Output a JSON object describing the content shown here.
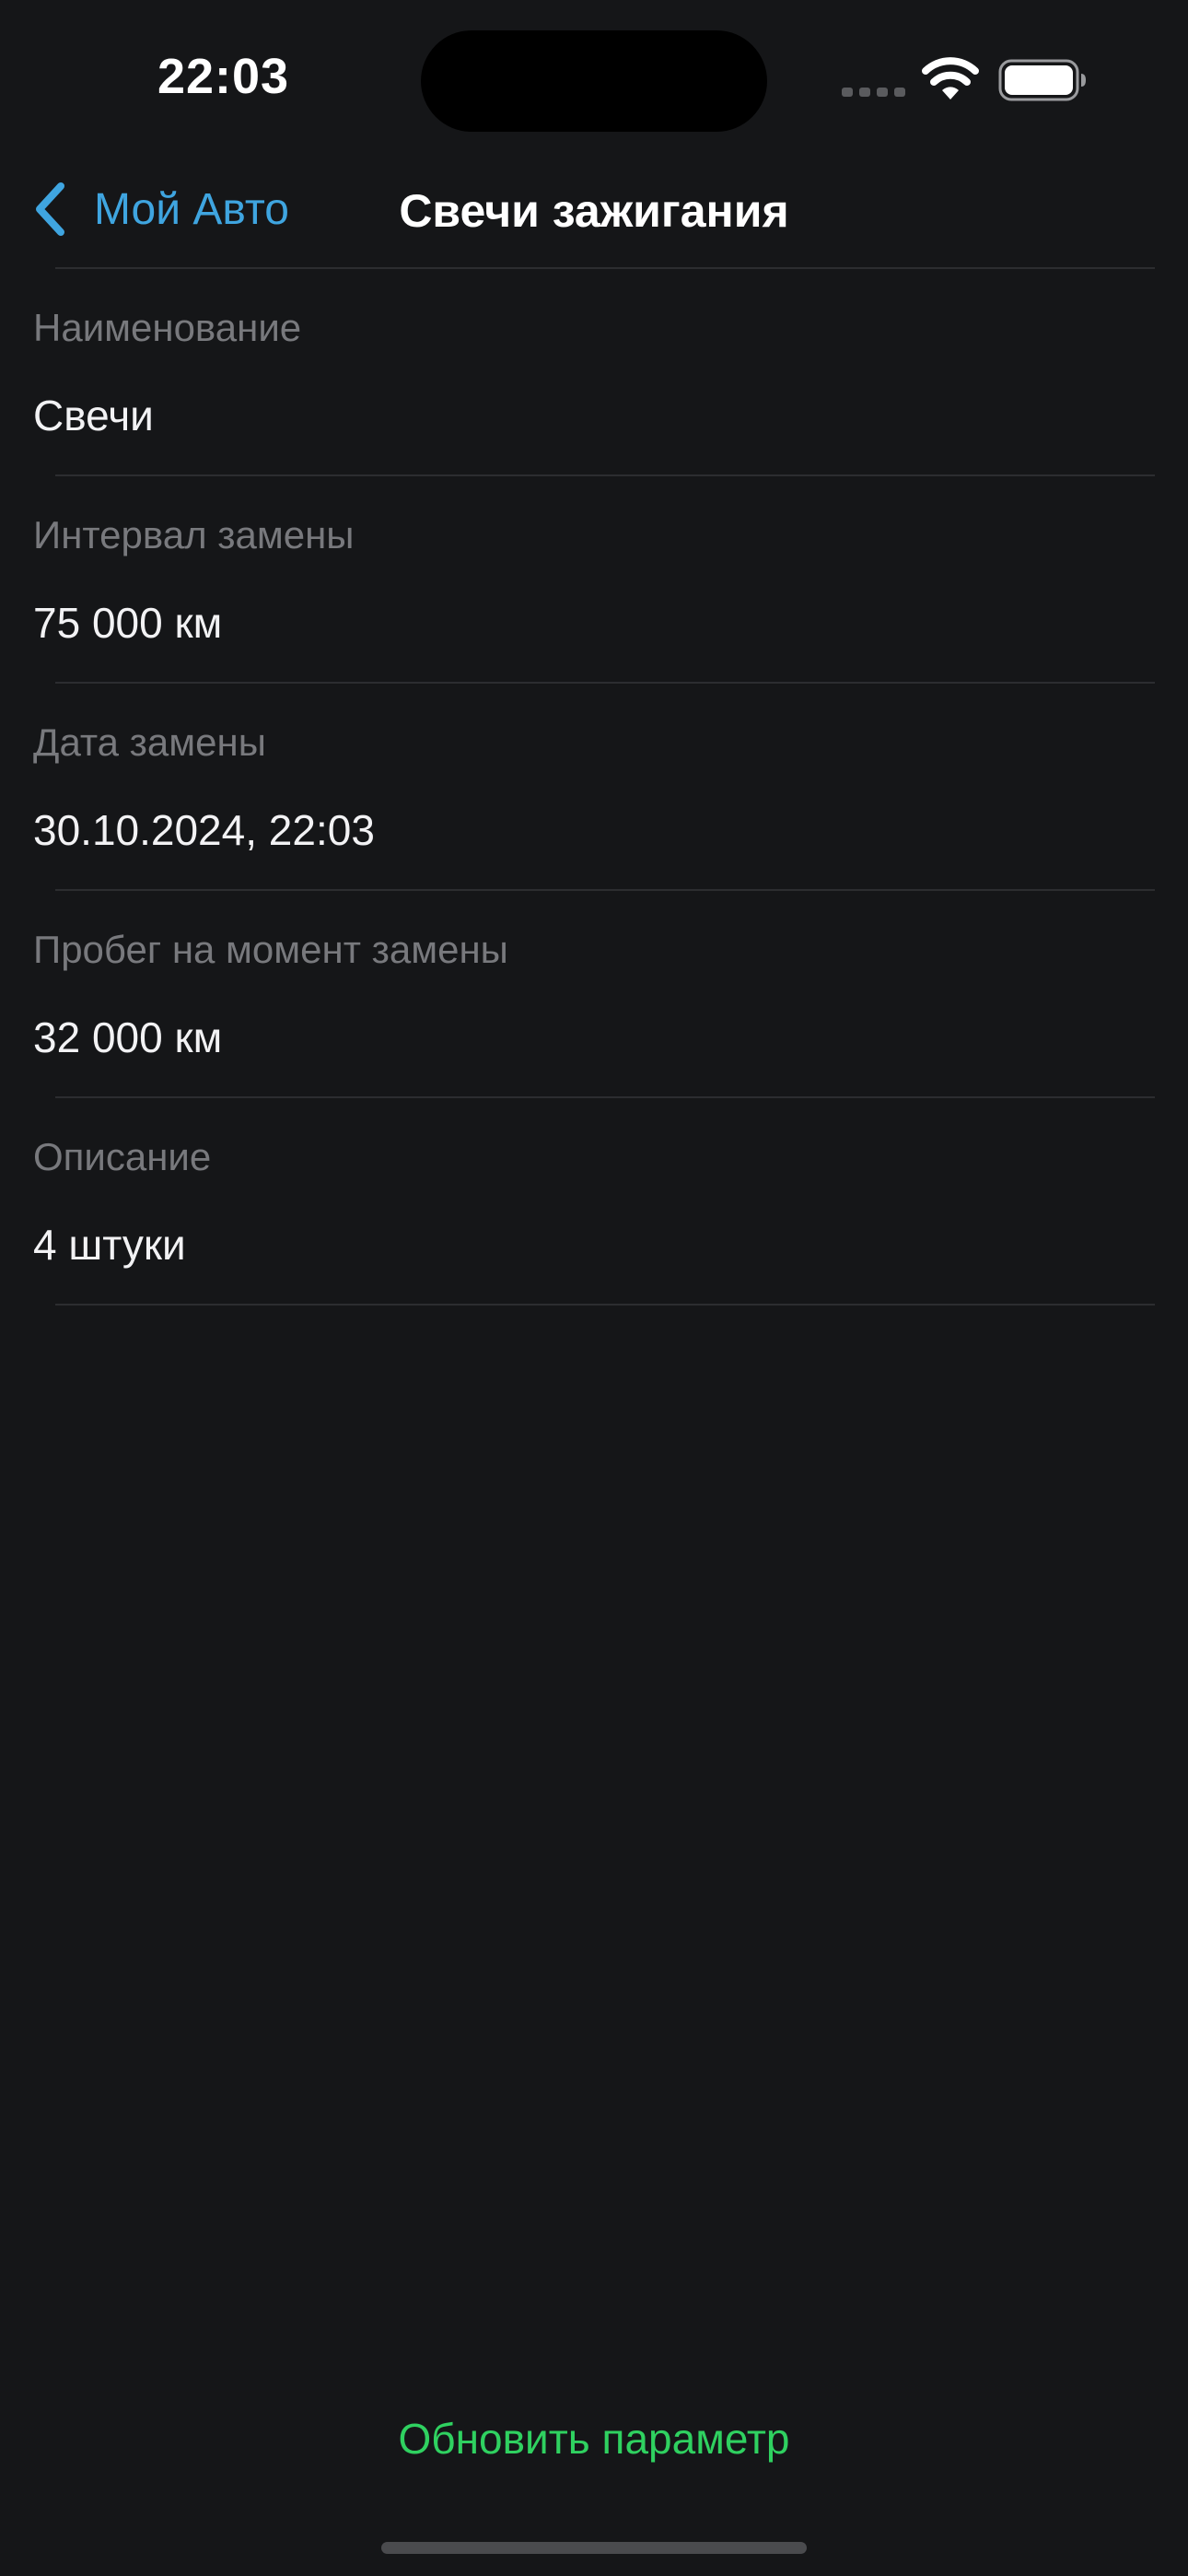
{
  "status_bar": {
    "time": "22:03",
    "icons": [
      "cellular-signal-icon",
      "wifi-icon",
      "battery-icon"
    ]
  },
  "nav": {
    "back_label": "Мой Авто",
    "back_icon": "chevron-left-icon",
    "title": "Свечи зажигания"
  },
  "fields": [
    {
      "label": "Наименование",
      "value": "Свечи"
    },
    {
      "label": "Интервал замены",
      "value": "75 000 км"
    },
    {
      "label": "Дата замены",
      "value": "30.10.2024, 22:03"
    },
    {
      "label": "Пробег на момент замены",
      "value": "32 000 км"
    },
    {
      "label": "Описание",
      "value": "4 штуки"
    }
  ],
  "actions": {
    "update_label": "Обновить параметр"
  },
  "colors": {
    "background": "#151618",
    "accent_blue": "#3fa5e0",
    "accent_green": "#2fd160",
    "label_gray": "#78797d",
    "separator": "#2c2d30"
  }
}
